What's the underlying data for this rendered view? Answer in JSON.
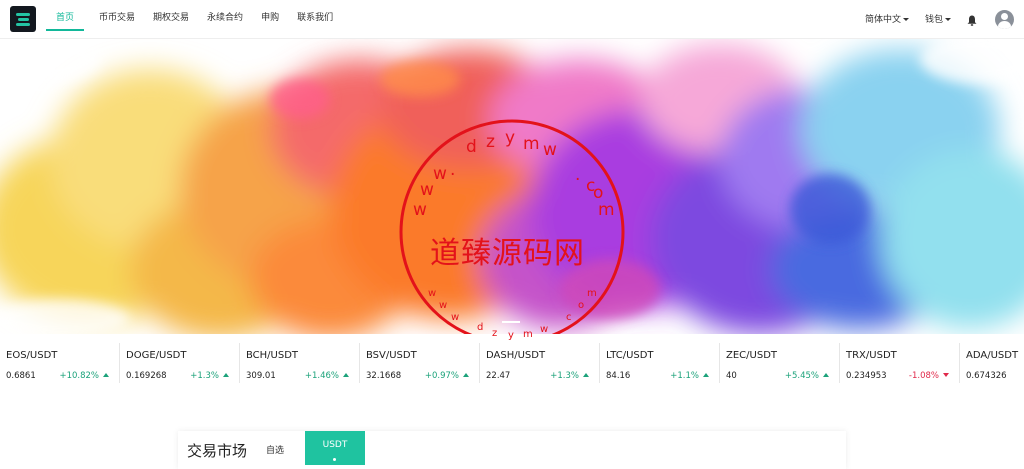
{
  "nav": {
    "items": [
      {
        "label": "首页",
        "active": true
      },
      {
        "label": "币币交易",
        "active": false
      },
      {
        "label": "期权交易",
        "active": false
      },
      {
        "label": "永续合约",
        "active": false
      },
      {
        "label": "申购",
        "active": false
      },
      {
        "label": "联系我们",
        "active": false
      }
    ],
    "language": "简体中文",
    "wallet": "钱包"
  },
  "icons": {
    "logo": "exchange-logo-icon",
    "bell": "bell-icon",
    "avatar": "user-avatar-icon"
  },
  "banner": {
    "watermark_text": "道臻源码网",
    "watermark_top": [
      "w",
      "w",
      "w",
      ".",
      "d",
      "z",
      "y",
      "m",
      "w",
      ".",
      "c",
      "o",
      "m"
    ],
    "watermark_bottom": [
      "w",
      "w",
      "w",
      "d",
      "z",
      "y",
      "m",
      "w",
      "c",
      "o",
      "m"
    ]
  },
  "tickers": [
    {
      "pair": "EOS/USDT",
      "price": "0.6861",
      "change": "+10.82%",
      "dir": "up"
    },
    {
      "pair": "DOGE/USDT",
      "price": "0.169268",
      "change": "+1.3%",
      "dir": "up"
    },
    {
      "pair": "BCH/USDT",
      "price": "309.01",
      "change": "+1.46%",
      "dir": "up"
    },
    {
      "pair": "BSV/USDT",
      "price": "32.1668",
      "change": "+0.97%",
      "dir": "up"
    },
    {
      "pair": "DASH/USDT",
      "price": "22.47",
      "change": "+1.3%",
      "dir": "up"
    },
    {
      "pair": "LTC/USDT",
      "price": "84.16",
      "change": "+1.1%",
      "dir": "up"
    },
    {
      "pair": "ZEC/USDT",
      "price": "40",
      "change": "+5.45%",
      "dir": "up"
    },
    {
      "pair": "TRX/USDT",
      "price": "0.234953",
      "change": "-1.08%",
      "dir": "down"
    },
    {
      "pair": "ADA/USDT",
      "price": "0.674326",
      "change": "",
      "dir": "up"
    }
  ],
  "market": {
    "title": "交易市场",
    "tab_favorites": "自选",
    "tab_usdt": "USDT"
  },
  "colors": {
    "accent": "#12b89a",
    "up": "#1ba27a",
    "down": "#e0294a",
    "stamp": "#e3121a"
  }
}
